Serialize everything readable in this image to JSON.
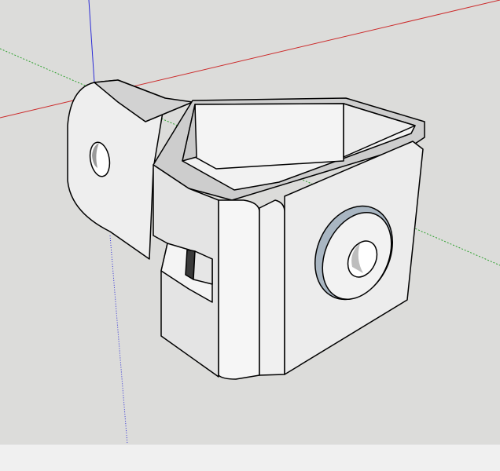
{
  "app": {
    "title": ""
  },
  "viewport": {
    "background": "#dcdcda",
    "axes": {
      "red": "#cc2b2b",
      "green": "#2ca02c",
      "blue": "#2b2bd6"
    },
    "model": {
      "name": "bracket-with-bolt-hole",
      "face_light": "#f1f1f1",
      "face_mid": "#e3e3e3",
      "face_dark": "#c6c6c6",
      "edge": "#000000",
      "washer": "#a9b6c2"
    }
  },
  "statusbar": {
    "text": ""
  }
}
